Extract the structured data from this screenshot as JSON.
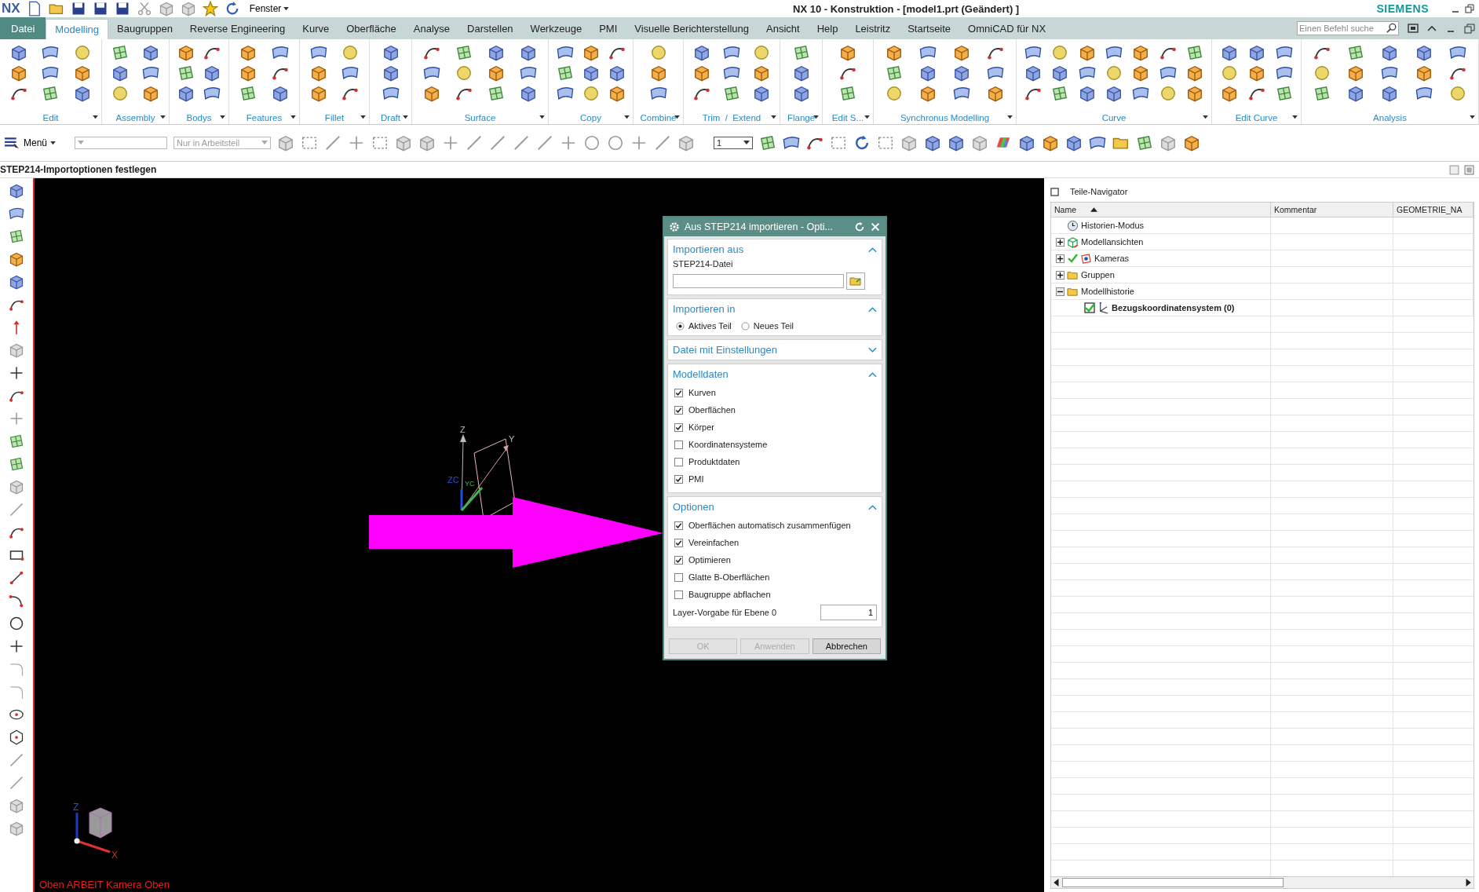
{
  "title_bar": {
    "app": "NX",
    "window_menu": "Fenster",
    "title": "NX 10 - Konstruktion - [model1.prt (Geändert) ]",
    "brand": "SIEMENS"
  },
  "tabs": [
    {
      "label": "Datei",
      "kind": "file",
      "selected": false
    },
    {
      "label": "Modelling",
      "kind": "tab",
      "selected": true
    },
    {
      "label": "Baugruppen",
      "kind": "tab",
      "selected": false
    },
    {
      "label": "Reverse Engineering",
      "kind": "tab",
      "selected": false
    },
    {
      "label": "Kurve",
      "kind": "tab",
      "selected": false
    },
    {
      "label": "Oberfläche",
      "kind": "tab",
      "selected": false
    },
    {
      "label": "Analyse",
      "kind": "tab",
      "selected": false
    },
    {
      "label": "Darstellen",
      "kind": "tab",
      "selected": false
    },
    {
      "label": "Werkzeuge",
      "kind": "tab",
      "selected": false
    },
    {
      "label": "PMI",
      "kind": "tab",
      "selected": false
    },
    {
      "label": "Visuelle Berichterstellung",
      "kind": "tab",
      "selected": false
    },
    {
      "label": "Ansicht",
      "kind": "tab",
      "selected": false
    },
    {
      "label": "Help",
      "kind": "tab",
      "selected": false
    },
    {
      "label": "Leistritz",
      "kind": "tab",
      "selected": false
    },
    {
      "label": "Startseite",
      "kind": "tab",
      "selected": false
    },
    {
      "label": "OmniCAD für NX",
      "kind": "tab",
      "selected": false
    }
  ],
  "command_search": {
    "placeholder": "Einen Befehl suche"
  },
  "ribbon_groups": [
    {
      "label": "Edit"
    },
    {
      "label": "Assembly"
    },
    {
      "label": "Bodys"
    },
    {
      "label": "Features"
    },
    {
      "label": "Fillet"
    },
    {
      "label": "Draft"
    },
    {
      "label": "Surface"
    },
    {
      "label": "Copy"
    },
    {
      "label": "Combine"
    },
    {
      "label": "Trim  /  Extend"
    },
    {
      "label": "Flange"
    },
    {
      "label": "Edit S..."
    },
    {
      "label": "Synchronus Modelling"
    },
    {
      "label": "Curve"
    },
    {
      "label": "Edit Curve"
    },
    {
      "label": "Analysis"
    }
  ],
  "toolbar": {
    "menu": "Menü",
    "scope_filter": "Nur in Arbeitsteil",
    "layer": "1"
  },
  "cue_line": "STEP214-Importoptionen festlegen",
  "viewport": {
    "view_label": "Oben ARBEIT Kamera Oben",
    "triad_labels": [
      "Z",
      "Y",
      "ZC",
      "YC"
    ],
    "corner_triad_labels": [
      "Z",
      "X"
    ]
  },
  "dialog": {
    "title": "Aus STEP214 importieren - Opti...",
    "sections": [
      {
        "title": "Importieren aus",
        "expanded": true,
        "items": [
          {
            "kind": "file",
            "label": "STEP214-Datei"
          }
        ]
      },
      {
        "title": "Importieren in",
        "expanded": true,
        "items": [
          {
            "kind": "radio",
            "options": [
              {
                "label": "Aktives Teil",
                "selected": true
              },
              {
                "label": "Neues Teil",
                "selected": false
              }
            ]
          }
        ]
      },
      {
        "title": "Datei mit Einstellungen",
        "expanded": false
      },
      {
        "title": "Modelldaten",
        "expanded": true,
        "items": [
          {
            "kind": "checkbox",
            "label": "Kurven",
            "checked": true
          },
          {
            "kind": "checkbox",
            "label": "Oberflächen",
            "checked": true
          },
          {
            "kind": "checkbox",
            "label": "Körper",
            "checked": true
          },
          {
            "kind": "checkbox",
            "label": "Koordinatensysteme",
            "checked": false
          },
          {
            "kind": "checkbox",
            "label": "Produktdaten",
            "checked": false
          },
          {
            "kind": "checkbox",
            "label": "PMI",
            "checked": true
          }
        ]
      },
      {
        "title": "Optionen",
        "expanded": true,
        "items": [
          {
            "kind": "checkbox",
            "label": "Oberflächen automatisch zusammenfügen",
            "checked": true
          },
          {
            "kind": "checkbox",
            "label": "Vereinfachen",
            "checked": true
          },
          {
            "kind": "checkbox",
            "label": "Optimieren",
            "checked": true
          },
          {
            "kind": "checkbox",
            "label": "Glatte B-Oberflächen",
            "checked": false
          },
          {
            "kind": "checkbox",
            "label": "Baugruppe abflachen",
            "checked": false
          },
          {
            "kind": "number",
            "label": "Layer-Vorgabe für Ebene 0",
            "value": "1"
          }
        ]
      }
    ],
    "buttons": [
      {
        "label": "OK",
        "disabled": true
      },
      {
        "label": "Anwenden",
        "disabled": true
      },
      {
        "label": "Abbrechen",
        "disabled": false
      }
    ]
  },
  "navigator": {
    "title": "Teile-Navigator",
    "columns": [
      "Name",
      "Kommentar",
      "GEOMETRIE_NA"
    ],
    "tree": [
      {
        "label": "Historien-Modus",
        "kind": "history",
        "expandable": false,
        "checked": false,
        "current": false
      },
      {
        "label": "Modellansichten",
        "kind": "views",
        "expandable": true,
        "expanded": false,
        "checked": false,
        "current": false
      },
      {
        "label": "Kameras",
        "kind": "cameras",
        "expandable": true,
        "expanded": false,
        "checked": true,
        "current": false
      },
      {
        "label": "Gruppen",
        "kind": "folder",
        "expandable": true,
        "expanded": false,
        "checked": false,
        "current": false
      },
      {
        "label": "Modellhistorie",
        "kind": "folder",
        "expandable": true,
        "expanded": true,
        "checked": false,
        "current": false,
        "children": [
          {
            "label": "Bezugskoordinatensystem (0)",
            "kind": "csys",
            "expandable": false,
            "checked": true,
            "current": true
          }
        ]
      }
    ]
  }
}
